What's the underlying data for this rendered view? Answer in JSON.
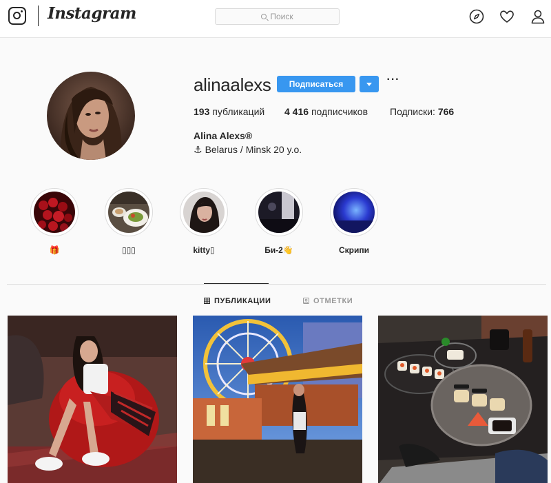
{
  "header": {
    "brand": "Instagram",
    "search_placeholder": "Поиск"
  },
  "profile": {
    "username": "alinaalexs",
    "follow_label": "Подписаться",
    "more_label": "···",
    "stats": {
      "posts_count": "193",
      "posts_label": "публикаций",
      "followers_count": "4 416",
      "followers_label": "подписчиков",
      "following_label": "Подписки:",
      "following_count": "766"
    },
    "full_name": "Alina Alexs®",
    "bio_icon": "⚓",
    "bio": "Belarus / Minsk 20 y.o."
  },
  "highlights": [
    {
      "label": "🎁",
      "icon": "gift-emoji"
    },
    {
      "label": "▯▯▯",
      "icon": "missing-glyph-boxes"
    },
    {
      "label": "kitty▯",
      "icon": "missing-glyph-box"
    },
    {
      "label": "Би-2👋",
      "icon": "hand-emoji"
    },
    {
      "label": "Скрипи",
      "icon": ""
    }
  ],
  "tabs": [
    {
      "label": "ПУБЛИКАЦИИ",
      "active": true,
      "icon": "grid-icon"
    },
    {
      "label": "ОТМЕТКИ",
      "active": false,
      "icon": "tag-icon"
    }
  ],
  "colors": {
    "accent": "#3897f0",
    "text": "#262626",
    "muted": "#999999",
    "border": "#dbdbdb",
    "background": "#fafafa"
  }
}
